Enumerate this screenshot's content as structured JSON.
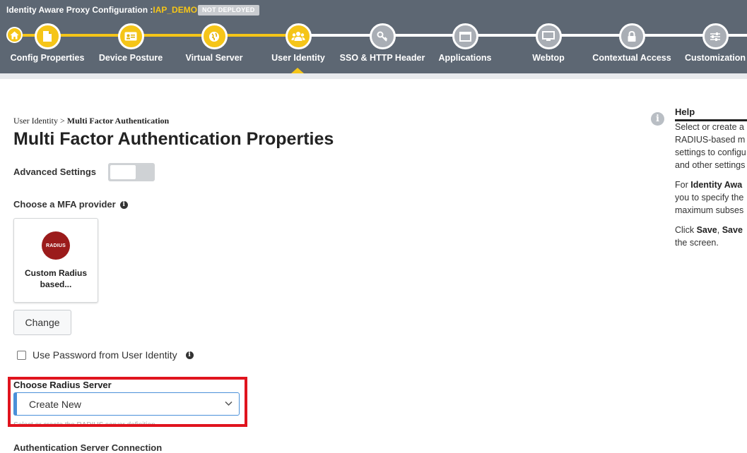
{
  "header": {
    "title_prefix": "Identity Aware Proxy Configuration :",
    "app_name": "IAP_DEMO",
    "status_badge": "NOT DEPLOYED"
  },
  "wizard": {
    "steps": [
      {
        "label": "Config Properties",
        "icon": "document-icon",
        "state": "done"
      },
      {
        "label": "Device Posture",
        "icon": "id-card-icon",
        "state": "done"
      },
      {
        "label": "Virtual Server",
        "icon": "globe-icon",
        "state": "done"
      },
      {
        "label": "User Identity",
        "icon": "users-icon",
        "state": "current"
      },
      {
        "label": "SSO & HTTP Header",
        "icon": "key-icon",
        "state": "todo"
      },
      {
        "label": "Applications",
        "icon": "window-icon",
        "state": "todo"
      },
      {
        "label": "Webtop",
        "icon": "monitor-icon",
        "state": "todo"
      },
      {
        "label": "Contextual Access",
        "icon": "lock-icon",
        "state": "todo"
      },
      {
        "label": "Customization",
        "icon": "sliders-icon",
        "state": "todo"
      }
    ]
  },
  "breadcrumb": {
    "parent": "User Identity",
    "separator": ">",
    "current": "Multi Factor Authentication"
  },
  "page": {
    "title": "Multi Factor Authentication Properties",
    "advanced_settings_label": "Advanced Settings",
    "advanced_settings_on": false,
    "mfa_provider_label": "Choose a MFA provider",
    "provider": {
      "logo_text": "RADIUS",
      "name": "Custom Radius based..."
    },
    "change_button": "Change",
    "use_password_label": "Use Password from User Identity",
    "use_password_checked": false,
    "radius_server_label": "Choose Radius Server",
    "radius_server_value": "Create New",
    "radius_server_hint": "Select or create the RADIUS server definition",
    "next_section_label": "Authentication Server Connection"
  },
  "help": {
    "title": "Help",
    "p1_lines": [
      "Select or create a",
      "RADIUS-based m",
      "settings to configu",
      "and other settings"
    ],
    "p2_prefix": "For ",
    "p2_bold": "Identity Awa",
    "p2_lines": [
      "you to specify the",
      "maximum subses"
    ],
    "p3_prefix": "Click ",
    "p3_bold1": "Save",
    "p3_sep": ", ",
    "p3_bold2": "Save",
    "p3_line2": "the screen."
  },
  "colors": {
    "header_bg": "#5d6773",
    "accent": "#f5c518",
    "highlight": "#e0141e",
    "select_border": "#4a90d9"
  }
}
